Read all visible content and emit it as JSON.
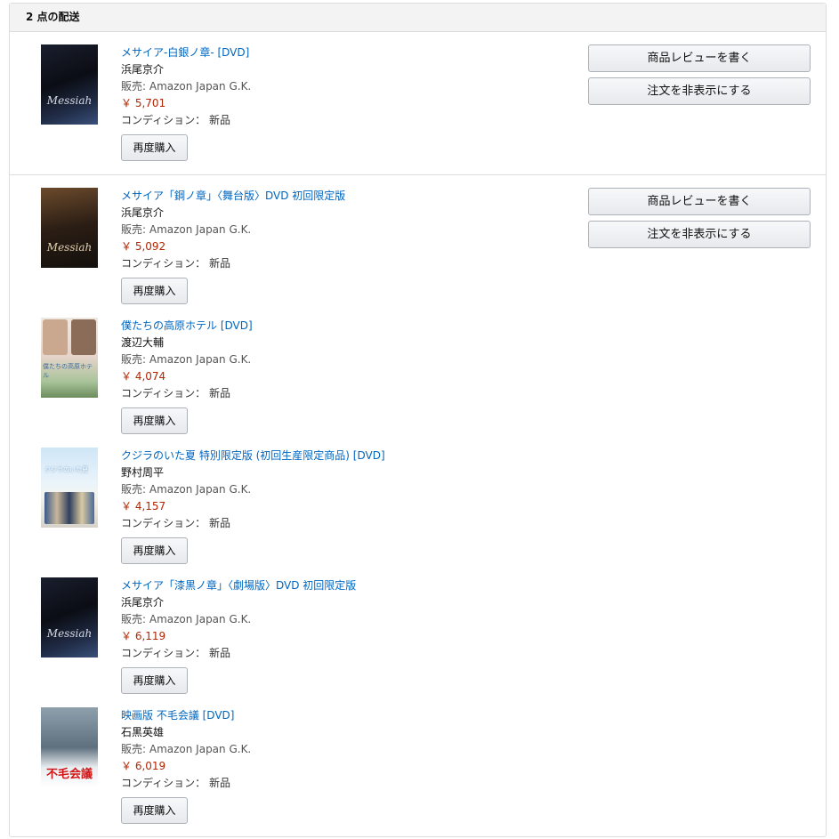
{
  "shipment_header": "2 点の配送",
  "side_buttons": {
    "review": "商品レビューを書く",
    "hide_order": "注文を非表示にする"
  },
  "labels": {
    "condition_label": "コンディション：",
    "rebuy": "再度購入"
  },
  "shipments": [
    {
      "items": [
        {
          "title": "メサイア-白銀ノ章- [DVD]",
          "author": "浜尾京介",
          "seller": "販売: Amazon Japan G.K.",
          "price": "￥ 5,701",
          "condition": "新品",
          "cover_text": "Messiah"
        }
      ]
    },
    {
      "items": [
        {
          "title": "メサイア「鋼ノ章」〈舞台版〉DVD 初回限定版",
          "author": "浜尾京介",
          "seller": "販売: Amazon Japan G.K.",
          "price": "￥ 5,092",
          "condition": "新品",
          "cover_text": "Messiah"
        },
        {
          "title": "僕たちの高原ホテル [DVD]",
          "author": "渡辺大輔",
          "seller": "販売: Amazon Japan G.K.",
          "price": "￥ 4,074",
          "condition": "新品",
          "cover_text": "僕たちの高原ホテル"
        },
        {
          "title": "クジラのいた夏 特別限定版 (初回生産限定商品) [DVD]",
          "author": "野村周平",
          "seller": "販売: Amazon Japan G.K.",
          "price": "￥ 4,157",
          "condition": "新品",
          "cover_text": "クジラのいた夏"
        },
        {
          "title": "メサイア「漆黒ノ章」〈劇場版〉DVD 初回限定版",
          "author": "浜尾京介",
          "seller": "販売: Amazon Japan G.K.",
          "price": "￥ 6,119",
          "condition": "新品",
          "cover_text": "Messiah"
        },
        {
          "title": "映画版 不毛会議 [DVD]",
          "author": "石黒英雄",
          "seller": "販売: Amazon Japan G.K.",
          "price": "￥ 6,019",
          "condition": "新品",
          "cover_text": "不毛会議"
        }
      ]
    }
  ]
}
